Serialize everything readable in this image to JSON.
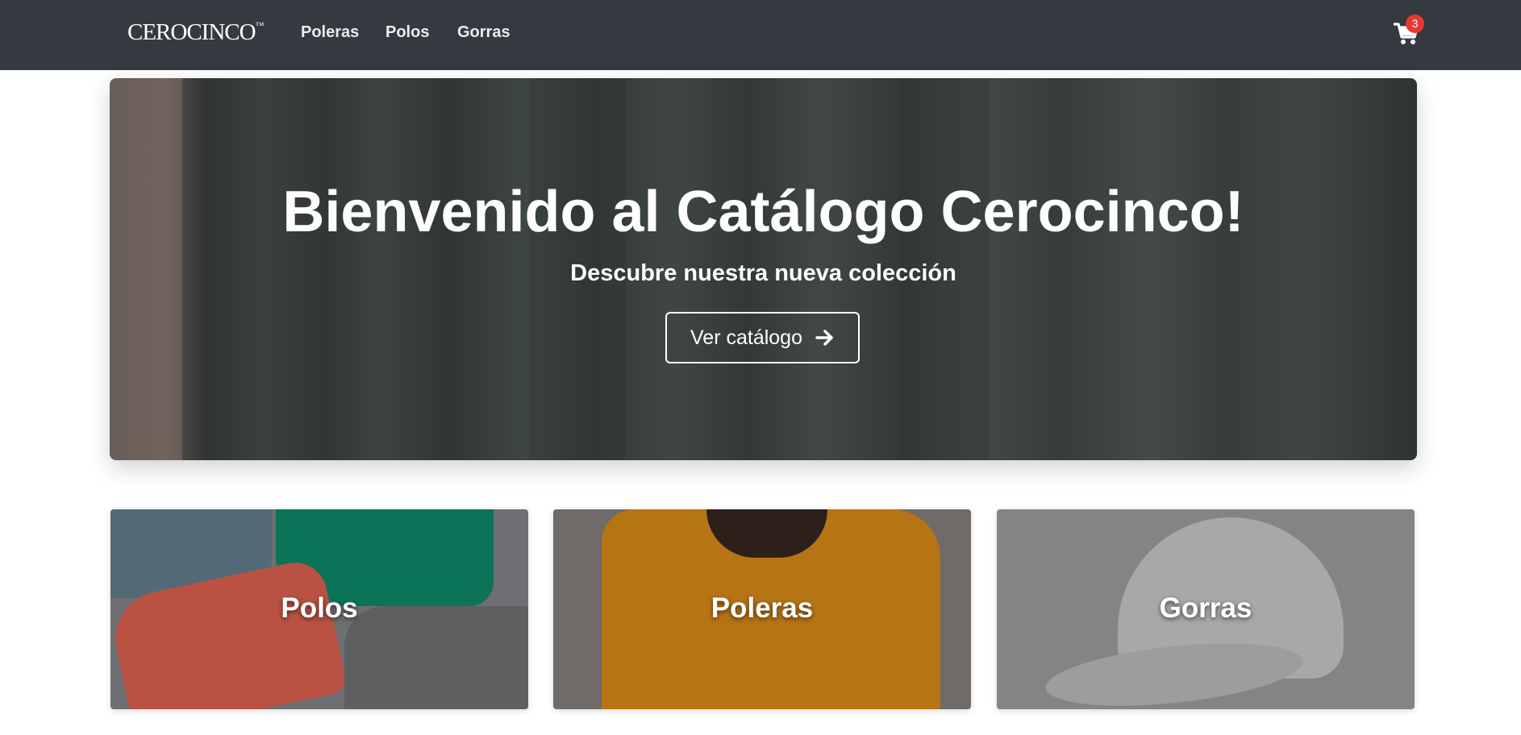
{
  "navbar": {
    "brand": "CEROCINCO",
    "brand_mark": "™",
    "links": [
      "Poleras",
      "Polos",
      "Gorras"
    ],
    "cart_count": "3",
    "cart_icon": "shopping-cart-icon"
  },
  "hero": {
    "title": "Bienvenido al Catálogo Cerocinco!",
    "subtitle": "Descubre nuestra nueva colección",
    "button_label": "Ver catálogo",
    "button_icon": "arrow-right-icon"
  },
  "categories": [
    {
      "label": "Polos"
    },
    {
      "label": "Poleras"
    },
    {
      "label": "Gorras"
    }
  ],
  "colors": {
    "navbar_bg": "#343a40",
    "badge": "#e53935",
    "text_light": "#ffffff"
  }
}
